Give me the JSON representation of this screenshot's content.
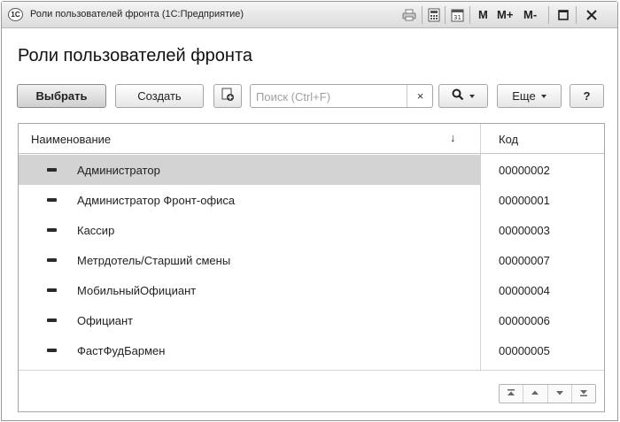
{
  "window": {
    "logo": "1С",
    "title": "Роли пользователей фронта  (1С:Предприятие)",
    "buttons": {
      "m": "M",
      "m_plus": "M+",
      "m_minus": "M-"
    }
  },
  "page": {
    "title": "Роли пользователей фронта"
  },
  "toolbar": {
    "select_label": "Выбрать",
    "create_label": "Создать",
    "search_placeholder": "Поиск (Ctrl+F)",
    "search_clear": "×",
    "more_label": "Еще",
    "help_label": "?"
  },
  "table": {
    "columns": {
      "name": "Наименование",
      "code": "Код"
    },
    "sort_indicator": "↓",
    "rows": [
      {
        "name": "Администратор",
        "code": "00000002",
        "selected": true
      },
      {
        "name": "Администратор Фронт-офиса",
        "code": "00000001"
      },
      {
        "name": "Кассир",
        "code": "00000003"
      },
      {
        "name": "Метрдотель/Старший смены",
        "code": "00000007"
      },
      {
        "name": "МобильныйОфициант",
        "code": "00000004"
      },
      {
        "name": "Официант",
        "code": "00000006"
      },
      {
        "name": "ФастФудБармен",
        "code": "00000005"
      }
    ]
  },
  "icons": {
    "print": "print-icon",
    "calculator": "calculator-icon",
    "calendar": "calendar-icon",
    "restore": "restore-window-icon",
    "close": "close-icon",
    "copy": "copy-icon",
    "search": "search-icon",
    "row": "catalog-item-icon",
    "nav": [
      "nav-first-icon",
      "nav-up-icon",
      "nav-down-icon",
      "nav-last-icon"
    ]
  },
  "colors": {
    "selected_row": "#d3d3d3",
    "border": "#a6a6a6"
  }
}
